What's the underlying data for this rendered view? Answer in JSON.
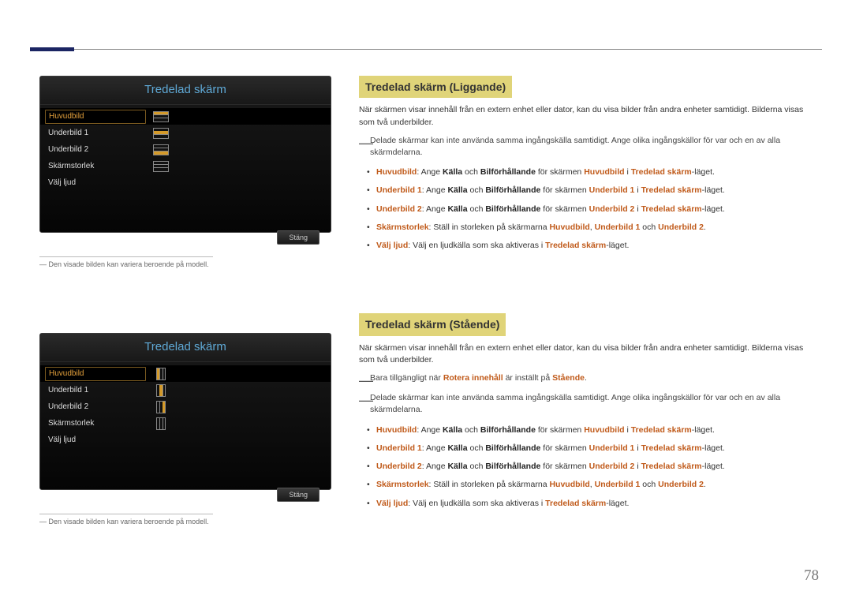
{
  "page_number": "78",
  "osd": {
    "title": "Tredelad skärm",
    "items": [
      "Huvudbild",
      "Underbild 1",
      "Underbild 2",
      "Skärmstorlek",
      "Välj ljud"
    ],
    "close_label": "Stäng"
  },
  "caption": "Den visade bilden kan variera beroende på modell.",
  "sec1": {
    "heading": "Tredelad skärm (Liggande)",
    "intro": "När skärmen visar innehåll från en extern enhet eller dator, kan du visa bilder från andra enheter samtidigt. Bilderna visas som två underbilder.",
    "note1_pre": "Delade skärmar kan inte använda samma ingångskälla samtidigt. Ange olika ingångskällor för var och en av alla skärmdelarna.",
    "b_huvudbild": "Huvudbild",
    "txt_ang_kb": ": Ange ",
    "b_kalla": "Källa",
    "txt_och": " och ",
    "b_bilf": "Bilförhållande",
    "txt_for_sk": " för skärmen ",
    "txt_i": " i ",
    "b_tred": "Tredelad skärm",
    "txt_laget": "-läget.",
    "b_underbild1": "Underbild 1",
    "b_underbild2": "Underbild 2",
    "b_skarmst": "Skärmstorlek",
    "txt_storlek": ": Ställ in storleken på skärmarna ",
    "txt_komma": ", ",
    "txt_och2": " och ",
    "txt_dot": ".",
    "b_valjljud": "Välj ljud",
    "txt_valjljud": ": Välj en ljudkälla som ska aktiveras i "
  },
  "sec2": {
    "heading": "Tredelad skärm (Stående)",
    "intro": "När skärmen visar innehåll från en extern enhet eller dator, kan du visa bilder från andra enheter samtidigt. Bilderna visas som två underbilder.",
    "note_rot_pre": "Bara tillgängligt när ",
    "note_rot_mid": "Rotera innehåll",
    "note_rot_mid2": " är inställt på ",
    "note_rot_end": "Stående",
    "note_rot_dot": "."
  }
}
